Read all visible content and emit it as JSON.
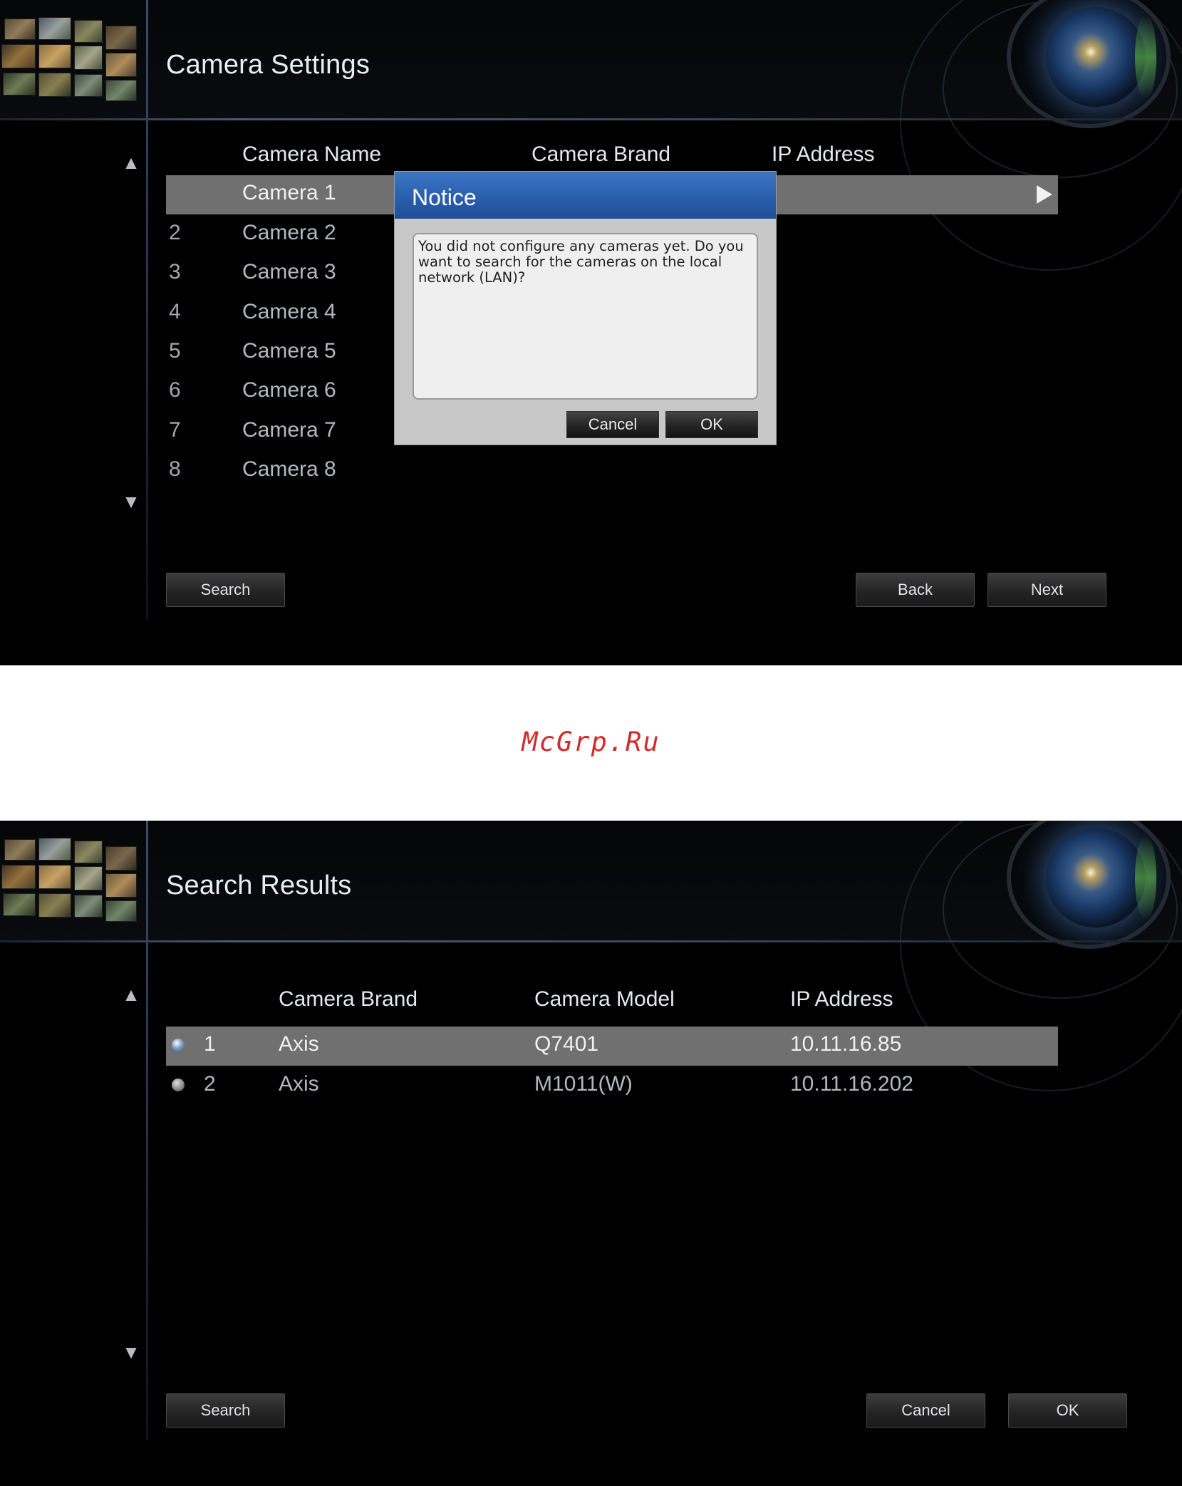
{
  "screen1": {
    "title": "Camera Settings",
    "columns": [
      "Camera Name",
      "Camera Brand",
      "IP Address"
    ],
    "rows": [
      {
        "num": "",
        "name": "Camera 1"
      },
      {
        "num": "2",
        "name": "Camera 2"
      },
      {
        "num": "3",
        "name": "Camera 3"
      },
      {
        "num": "4",
        "name": "Camera 4"
      },
      {
        "num": "5",
        "name": "Camera 5"
      },
      {
        "num": "6",
        "name": "Camera 6"
      },
      {
        "num": "7",
        "name": "Camera 7"
      },
      {
        "num": "8",
        "name": "Camera 8"
      }
    ],
    "buttons": {
      "search": "Search",
      "back": "Back",
      "next": "Next"
    },
    "dialog": {
      "title": "Notice",
      "message": "You did not configure any cameras yet. Do you want to search for the cameras on the local network (LAN)?",
      "cancel": "Cancel",
      "ok": "OK"
    }
  },
  "watermark": "McGrp.Ru",
  "screen2": {
    "title": "Search Results",
    "columns": [
      "Camera Brand",
      "Camera Model",
      "IP Address"
    ],
    "rows": [
      {
        "num": "1",
        "brand": "Axis",
        "model": "Q7401",
        "ip": "10.11.16.85"
      },
      {
        "num": "2",
        "brand": "Axis",
        "model": "M1011(W)",
        "ip": "10.11.16.202"
      }
    ],
    "buttons": {
      "search": "Search",
      "cancel": "Cancel",
      "ok": "OK"
    }
  },
  "icons": {
    "scroll_up": "▲",
    "scroll_down": "▼"
  }
}
